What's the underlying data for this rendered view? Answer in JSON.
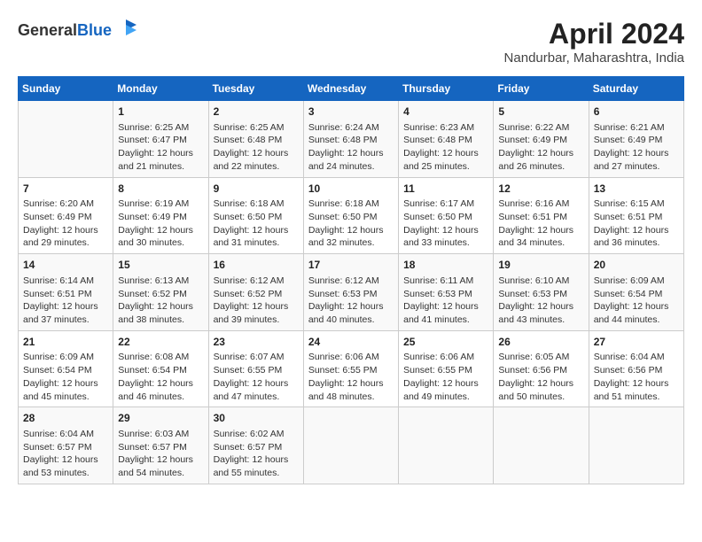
{
  "header": {
    "logo_general": "General",
    "logo_blue": "Blue",
    "title": "April 2024",
    "subtitle": "Nandurbar, Maharashtra, India"
  },
  "calendar": {
    "days": [
      "Sunday",
      "Monday",
      "Tuesday",
      "Wednesday",
      "Thursday",
      "Friday",
      "Saturday"
    ],
    "weeks": [
      [
        {
          "date": "",
          "info": ""
        },
        {
          "date": "1",
          "info": "Sunrise: 6:25 AM\nSunset: 6:47 PM\nDaylight: 12 hours\nand 21 minutes."
        },
        {
          "date": "2",
          "info": "Sunrise: 6:25 AM\nSunset: 6:48 PM\nDaylight: 12 hours\nand 22 minutes."
        },
        {
          "date": "3",
          "info": "Sunrise: 6:24 AM\nSunset: 6:48 PM\nDaylight: 12 hours\nand 24 minutes."
        },
        {
          "date": "4",
          "info": "Sunrise: 6:23 AM\nSunset: 6:48 PM\nDaylight: 12 hours\nand 25 minutes."
        },
        {
          "date": "5",
          "info": "Sunrise: 6:22 AM\nSunset: 6:49 PM\nDaylight: 12 hours\nand 26 minutes."
        },
        {
          "date": "6",
          "info": "Sunrise: 6:21 AM\nSunset: 6:49 PM\nDaylight: 12 hours\nand 27 minutes."
        }
      ],
      [
        {
          "date": "7",
          "info": "Sunrise: 6:20 AM\nSunset: 6:49 PM\nDaylight: 12 hours\nand 29 minutes."
        },
        {
          "date": "8",
          "info": "Sunrise: 6:19 AM\nSunset: 6:49 PM\nDaylight: 12 hours\nand 30 minutes."
        },
        {
          "date": "9",
          "info": "Sunrise: 6:18 AM\nSunset: 6:50 PM\nDaylight: 12 hours\nand 31 minutes."
        },
        {
          "date": "10",
          "info": "Sunrise: 6:18 AM\nSunset: 6:50 PM\nDaylight: 12 hours\nand 32 minutes."
        },
        {
          "date": "11",
          "info": "Sunrise: 6:17 AM\nSunset: 6:50 PM\nDaylight: 12 hours\nand 33 minutes."
        },
        {
          "date": "12",
          "info": "Sunrise: 6:16 AM\nSunset: 6:51 PM\nDaylight: 12 hours\nand 34 minutes."
        },
        {
          "date": "13",
          "info": "Sunrise: 6:15 AM\nSunset: 6:51 PM\nDaylight: 12 hours\nand 36 minutes."
        }
      ],
      [
        {
          "date": "14",
          "info": "Sunrise: 6:14 AM\nSunset: 6:51 PM\nDaylight: 12 hours\nand 37 minutes."
        },
        {
          "date": "15",
          "info": "Sunrise: 6:13 AM\nSunset: 6:52 PM\nDaylight: 12 hours\nand 38 minutes."
        },
        {
          "date": "16",
          "info": "Sunrise: 6:12 AM\nSunset: 6:52 PM\nDaylight: 12 hours\nand 39 minutes."
        },
        {
          "date": "17",
          "info": "Sunrise: 6:12 AM\nSunset: 6:53 PM\nDaylight: 12 hours\nand 40 minutes."
        },
        {
          "date": "18",
          "info": "Sunrise: 6:11 AM\nSunset: 6:53 PM\nDaylight: 12 hours\nand 41 minutes."
        },
        {
          "date": "19",
          "info": "Sunrise: 6:10 AM\nSunset: 6:53 PM\nDaylight: 12 hours\nand 43 minutes."
        },
        {
          "date": "20",
          "info": "Sunrise: 6:09 AM\nSunset: 6:54 PM\nDaylight: 12 hours\nand 44 minutes."
        }
      ],
      [
        {
          "date": "21",
          "info": "Sunrise: 6:09 AM\nSunset: 6:54 PM\nDaylight: 12 hours\nand 45 minutes."
        },
        {
          "date": "22",
          "info": "Sunrise: 6:08 AM\nSunset: 6:54 PM\nDaylight: 12 hours\nand 46 minutes."
        },
        {
          "date": "23",
          "info": "Sunrise: 6:07 AM\nSunset: 6:55 PM\nDaylight: 12 hours\nand 47 minutes."
        },
        {
          "date": "24",
          "info": "Sunrise: 6:06 AM\nSunset: 6:55 PM\nDaylight: 12 hours\nand 48 minutes."
        },
        {
          "date": "25",
          "info": "Sunrise: 6:06 AM\nSunset: 6:55 PM\nDaylight: 12 hours\nand 49 minutes."
        },
        {
          "date": "26",
          "info": "Sunrise: 6:05 AM\nSunset: 6:56 PM\nDaylight: 12 hours\nand 50 minutes."
        },
        {
          "date": "27",
          "info": "Sunrise: 6:04 AM\nSunset: 6:56 PM\nDaylight: 12 hours\nand 51 minutes."
        }
      ],
      [
        {
          "date": "28",
          "info": "Sunrise: 6:04 AM\nSunset: 6:57 PM\nDaylight: 12 hours\nand 53 minutes."
        },
        {
          "date": "29",
          "info": "Sunrise: 6:03 AM\nSunset: 6:57 PM\nDaylight: 12 hours\nand 54 minutes."
        },
        {
          "date": "30",
          "info": "Sunrise: 6:02 AM\nSunset: 6:57 PM\nDaylight: 12 hours\nand 55 minutes."
        },
        {
          "date": "",
          "info": ""
        },
        {
          "date": "",
          "info": ""
        },
        {
          "date": "",
          "info": ""
        },
        {
          "date": "",
          "info": ""
        }
      ]
    ]
  }
}
